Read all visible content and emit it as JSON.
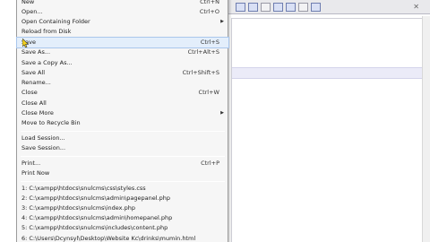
{
  "menu": {
    "items": [
      {
        "label": "New",
        "shortcut": "Ctrl+N"
      },
      {
        "label": "Open...",
        "shortcut": "Ctrl+O"
      },
      {
        "label": "Open Containing Folder",
        "arrow": "▶"
      },
      {
        "label": "Reload from Disk"
      },
      {
        "label": "Save",
        "shortcut": "Ctrl+S"
      },
      {
        "label": "Save As...",
        "shortcut": "Ctrl+Alt+S"
      },
      {
        "label": "Save a Copy As..."
      },
      {
        "label": "Save All",
        "shortcut": "Ctrl+Shift+S"
      },
      {
        "label": "Rename..."
      },
      {
        "label": "Close",
        "shortcut": "Ctrl+W"
      },
      {
        "label": "Close All"
      },
      {
        "label": "Close More",
        "arrow": "▶"
      },
      {
        "label": "Move to Recycle Bin"
      },
      {
        "label": "Load Session..."
      },
      {
        "label": "Save Session..."
      },
      {
        "label": "Print...",
        "shortcut": "Ctrl+P"
      },
      {
        "label": "Print Now"
      },
      {
        "label": "1: C:\\xampp\\htdocs\\snulcms\\css\\styles.css"
      },
      {
        "label": "2: C:\\xampp\\htdocs\\snulcms\\admin\\pagepanel.php"
      },
      {
        "label": "3: C:\\xampp\\htdocs\\snulcms\\index.php"
      },
      {
        "label": "4: C:\\xampp\\htdocs\\snulcms\\admin\\homepanel.php"
      },
      {
        "label": "5: C:\\xampp\\htdocs\\snulcms\\includes\\content.php"
      },
      {
        "label": "6: C:\\Users\\Dcynsyl\\Desktop\\Website Kc\\drinks\\mumin.html"
      }
    ]
  },
  "colors": {
    "menu_bg": "#f6f6f6",
    "highlight": "#e3eefb",
    "highlight_border": "#a9c6ec",
    "editor_line_highlight": "#ebebf8"
  }
}
